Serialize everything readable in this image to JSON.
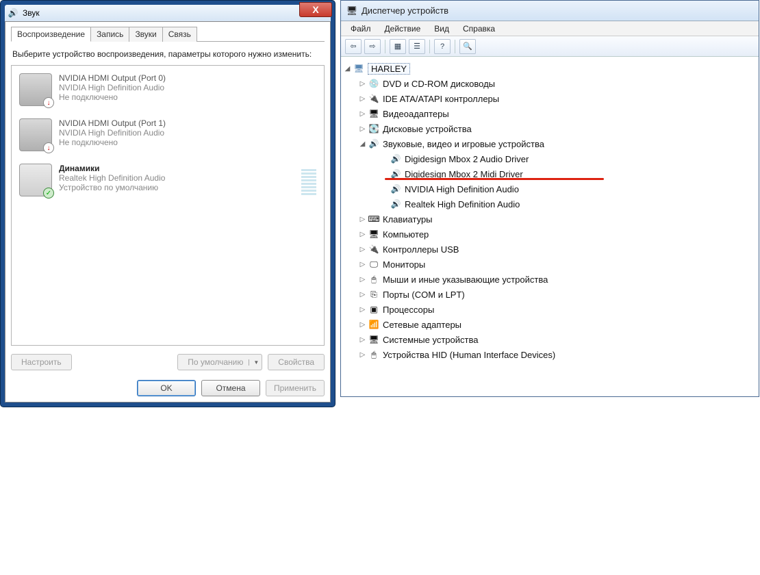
{
  "sound": {
    "title": "Звук",
    "close": "X",
    "tabs": [
      "Воспроизведение",
      "Запись",
      "Звуки",
      "Связь"
    ],
    "active_tab": 0,
    "instruction": "Выберите устройство воспроизведения, параметры которого нужно изменить:",
    "devices": [
      {
        "name": "NVIDIA HDMI Output (Port 0)",
        "driver": "NVIDIA High Definition Audio",
        "status": "Не подключено",
        "kind": "monitor",
        "badge": "down"
      },
      {
        "name": "NVIDIA HDMI Output (Port 1)",
        "driver": "NVIDIA High Definition Audio",
        "status": "Не подключено",
        "kind": "monitor",
        "badge": "down"
      },
      {
        "name": "Динамики",
        "driver": "Realtek High Definition Audio",
        "status": "Устройство по умолчанию",
        "kind": "speaker",
        "badge": "ok",
        "default": true
      }
    ],
    "buttons": {
      "configure": "Настроить",
      "set_default": "По умолчанию",
      "properties": "Свойства",
      "ok": "OK",
      "cancel": "Отмена",
      "apply": "Применить"
    }
  },
  "devmgr": {
    "title": "Диспетчер устройств",
    "menu": [
      "Файл",
      "Действие",
      "Вид",
      "Справка"
    ],
    "root": "HARLEY",
    "categories": [
      {
        "label": "DVD и CD-ROM дисководы",
        "icon": "disc",
        "expanded": false
      },
      {
        "label": "IDE ATA/ATAPI контроллеры",
        "icon": "ide",
        "expanded": false
      },
      {
        "label": "Видеоадаптеры",
        "icon": "gpu",
        "expanded": false
      },
      {
        "label": "Дисковые устройства",
        "icon": "disk",
        "expanded": false
      },
      {
        "label": "Звуковые, видео и игровые устройства",
        "icon": "speak",
        "expanded": true,
        "children": [
          "Digidesign Mbox 2 Audio Driver",
          "Digidesign Mbox 2 Midi Driver",
          "NVIDIA High Definition Audio",
          "Realtek High Definition Audio"
        ],
        "highlight_index": 0
      },
      {
        "label": "Клавиатуры",
        "icon": "kb",
        "expanded": false
      },
      {
        "label": "Компьютер",
        "icon": "pc",
        "expanded": false
      },
      {
        "label": "Контроллеры USB",
        "icon": "usb",
        "expanded": false
      },
      {
        "label": "Мониторы",
        "icon": "mon",
        "expanded": false
      },
      {
        "label": "Мыши и иные указывающие устройства",
        "icon": "mouse",
        "expanded": false
      },
      {
        "label": "Порты (COM и LPT)",
        "icon": "port",
        "expanded": false
      },
      {
        "label": "Процессоры",
        "icon": "cpu",
        "expanded": false
      },
      {
        "label": "Сетевые адаптеры",
        "icon": "net",
        "expanded": false
      },
      {
        "label": "Системные устройства",
        "icon": "sys",
        "expanded": false
      },
      {
        "label": "Устройства HID (Human Interface Devices)",
        "icon": "hid",
        "expanded": false
      }
    ]
  }
}
